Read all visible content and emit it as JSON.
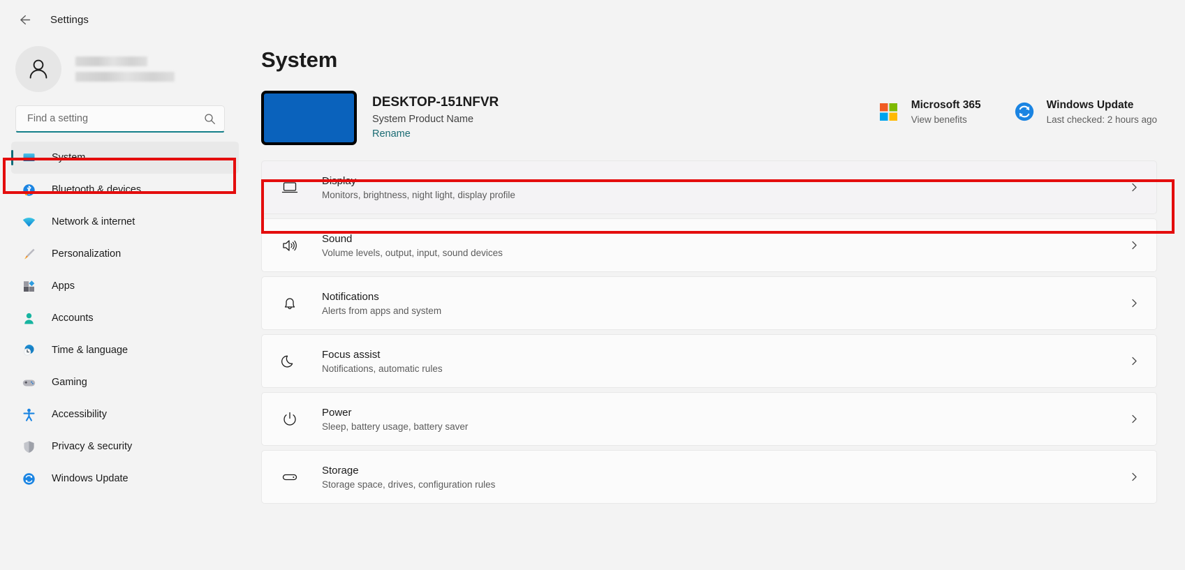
{
  "window": {
    "back_label": "Back",
    "title": "Settings"
  },
  "account": {
    "avatar_icon": "person-icon",
    "name_redacted": "",
    "email_redacted": ""
  },
  "search": {
    "placeholder": "Find a setting",
    "value": "",
    "icon": "search-icon"
  },
  "sidebar": {
    "items": [
      {
        "label": "System",
        "icon": "system-monitor-icon",
        "selected": true
      },
      {
        "label": "Bluetooth & devices",
        "icon": "bluetooth-icon",
        "selected": false
      },
      {
        "label": "Network & internet",
        "icon": "wifi-icon",
        "selected": false
      },
      {
        "label": "Personalization",
        "icon": "paintbrush-icon",
        "selected": false
      },
      {
        "label": "Apps",
        "icon": "apps-icon",
        "selected": false
      },
      {
        "label": "Accounts",
        "icon": "account-person-icon",
        "selected": false
      },
      {
        "label": "Time & language",
        "icon": "clock-globe-icon",
        "selected": false
      },
      {
        "label": "Gaming",
        "icon": "gamepad-icon",
        "selected": false
      },
      {
        "label": "Accessibility",
        "icon": "accessibility-person-icon",
        "selected": false
      },
      {
        "label": "Privacy & security",
        "icon": "shield-icon",
        "selected": false
      },
      {
        "label": "Windows Update",
        "icon": "update-refresh-icon",
        "selected": false
      }
    ]
  },
  "main": {
    "page_title": "System",
    "device": {
      "thumbnail_color": "#0a62bc",
      "name": "DESKTOP-151NFVR",
      "model": "System Product Name",
      "rename_label": "Rename"
    },
    "cards": [
      {
        "title": "Microsoft 365",
        "subtitle": "View benefits",
        "icon": "microsoft-logo-icon"
      },
      {
        "title": "Windows Update",
        "subtitle": "Last checked: 2 hours ago",
        "icon": "update-refresh-icon"
      }
    ],
    "rows": [
      {
        "title": "Display",
        "subtitle": "Monitors, brightness, night light, display profile",
        "icon": "monitor-icon",
        "highlighted": true
      },
      {
        "title": "Sound",
        "subtitle": "Volume levels, output, input, sound devices",
        "icon": "speaker-icon",
        "highlighted": false
      },
      {
        "title": "Notifications",
        "subtitle": "Alerts from apps and system",
        "icon": "bell-icon",
        "highlighted": false
      },
      {
        "title": "Focus assist",
        "subtitle": "Notifications, automatic rules",
        "icon": "moon-icon",
        "highlighted": false
      },
      {
        "title": "Power",
        "subtitle": "Sleep, battery usage, battery saver",
        "icon": "power-icon",
        "highlighted": false
      },
      {
        "title": "Storage",
        "subtitle": "Storage space, drives, configuration rules",
        "icon": "drive-icon",
        "highlighted": false
      }
    ],
    "chevron_icon": "chevron-right-icon"
  },
  "annotations": {
    "accent_color": "#e40d0d",
    "highlight_sidebar": "System",
    "highlight_row": "Display"
  }
}
